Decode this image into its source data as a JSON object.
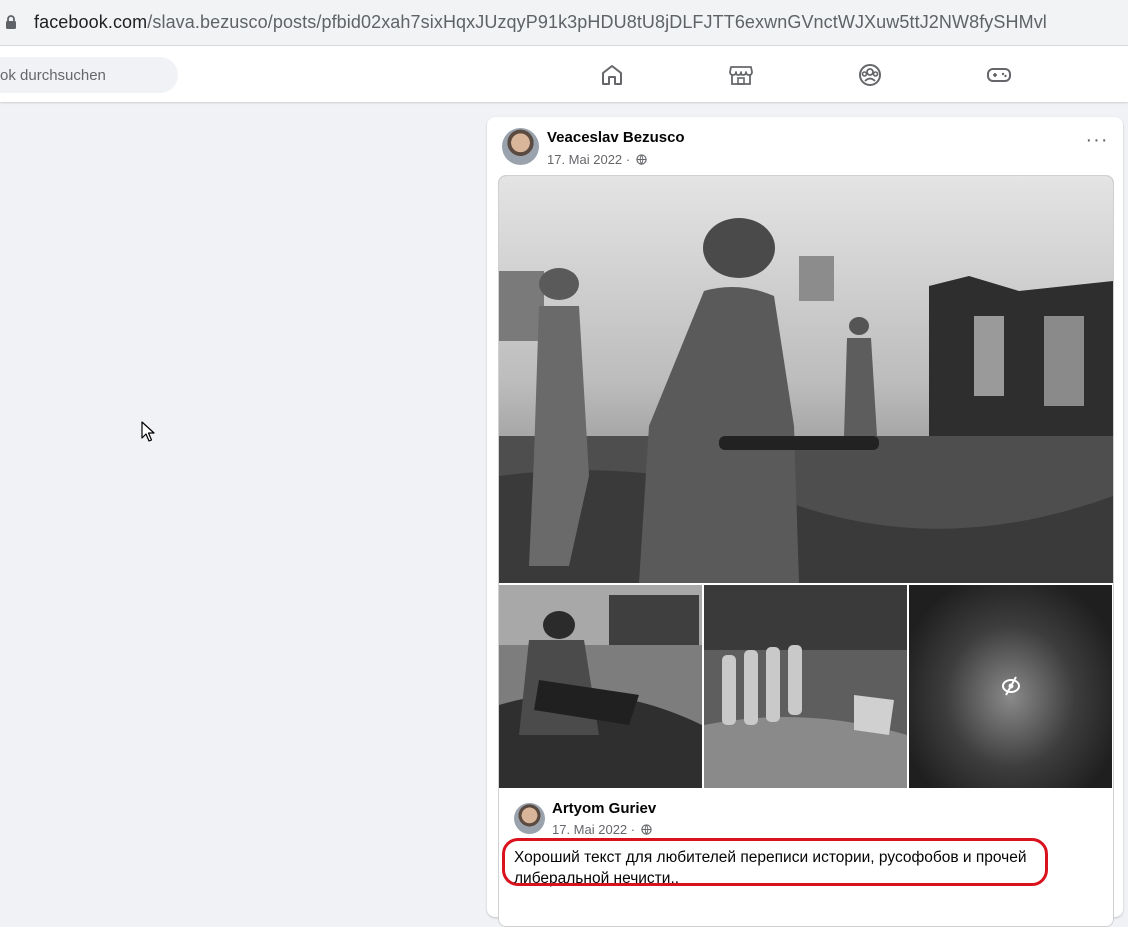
{
  "browser": {
    "url_domain": "facebook.com",
    "url_path": "/slava.bezusco/posts/pfbid02xah7sixHqxJUzqyP91k3pHDU8tU8jDLFJTT6exwnGVnctWJXuw5ttJ2NW8fySHMvl"
  },
  "nav": {
    "search_placeholder": "ok durchsuchen",
    "icons": [
      "home-icon",
      "marketplace-icon",
      "groups-icon",
      "gaming-icon"
    ]
  },
  "post": {
    "author": "Veaceslav Bezusco",
    "date": "17. Mai 2022",
    "separator": " · ",
    "more_label": "···",
    "shared": {
      "author": "Artyom Guriev",
      "date": "17. Mai 2022",
      "text": "Хороший текст для любителей переписи истории, русофобов и прочей либеральной нечисти.."
    }
  },
  "colors": {
    "facebook_bg": "#f0f2f5",
    "highlight": "#d9121d",
    "secondary_text": "#65676b"
  }
}
